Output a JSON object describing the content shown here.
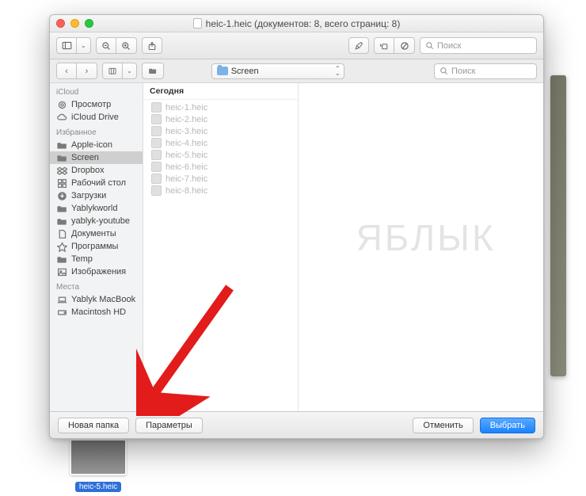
{
  "window": {
    "title": "heic-1.heic (документов: 8, всего страниц: 8)"
  },
  "main_toolbar": {
    "search_placeholder": "Поиск"
  },
  "sheet_toolbar": {
    "location": "Screen",
    "search_placeholder": "Поиск"
  },
  "sidebar": {
    "sections": [
      {
        "title": "iCloud",
        "items": [
          {
            "label": "Просмотр",
            "icon": "preview"
          },
          {
            "label": "iCloud Drive",
            "icon": "cloud"
          }
        ]
      },
      {
        "title": "Избранное",
        "items": [
          {
            "label": "Apple-icon",
            "icon": "folder"
          },
          {
            "label": "Screen",
            "icon": "folder",
            "selected": true
          },
          {
            "label": "Dropbox",
            "icon": "dropbox"
          },
          {
            "label": "Рабочий стол",
            "icon": "grid"
          },
          {
            "label": "Загрузки",
            "icon": "download"
          },
          {
            "label": "Yablykworld",
            "icon": "folder"
          },
          {
            "label": "yablyk-youtube",
            "icon": "folder"
          },
          {
            "label": "Документы",
            "icon": "doc"
          },
          {
            "label": "Программы",
            "icon": "app"
          },
          {
            "label": "Temp",
            "icon": "folder"
          },
          {
            "label": "Изображения",
            "icon": "image"
          }
        ]
      },
      {
        "title": "Места",
        "items": [
          {
            "label": "Yablyk MacBook",
            "icon": "laptop"
          },
          {
            "label": "Macintosh HD",
            "icon": "disk"
          }
        ]
      }
    ]
  },
  "column": {
    "header": "Сегодня",
    "files": [
      "heic-1.heic",
      "heic-2.heic",
      "heic-3.heic",
      "heic-4.heic",
      "heic-5.heic",
      "heic-6.heic",
      "heic-7.heic",
      "heic-8.heic"
    ]
  },
  "footer": {
    "new_folder": "Новая папка",
    "options": "Параметры",
    "cancel": "Отменить",
    "choose": "Выбрать"
  },
  "watermark": "ЯБЛЫК",
  "background": {
    "thumb_label": "heic-5.heic"
  }
}
